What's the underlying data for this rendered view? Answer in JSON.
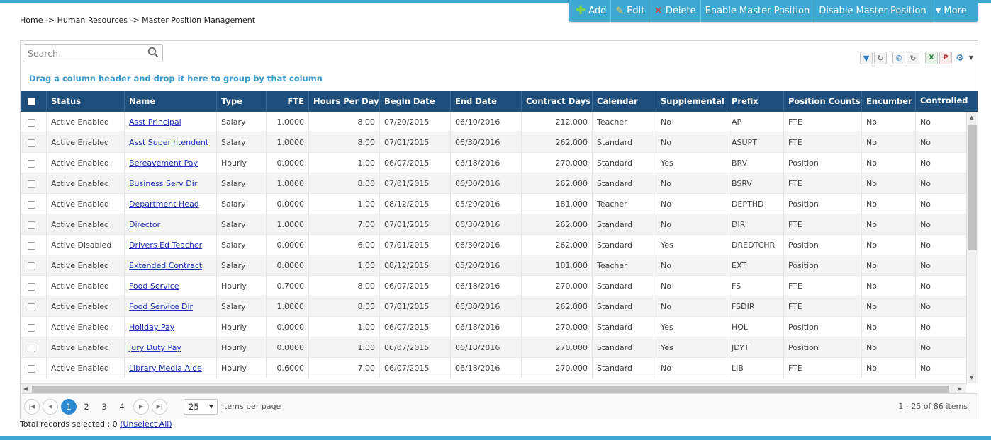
{
  "breadcrumb": "Home -> Human Resources -> Master Position Management",
  "toolbar": {
    "add": "Add",
    "edit": "Edit",
    "delete": "Delete",
    "enable": "Enable Master Position",
    "disable": "Disable Master Position",
    "more": "More"
  },
  "search": {
    "placeholder": "Search"
  },
  "group_hint": "Drag a column header and drop it here to group by that column",
  "columns": [
    "Status",
    "Name",
    "Type",
    "FTE",
    "Hours Per Day",
    "Begin Date",
    "End Date",
    "Contract Days",
    "Calendar",
    "Supplemental",
    "Prefix",
    "Position Counts",
    "Encumber",
    "Controlled"
  ],
  "rows": [
    [
      "Active Enabled",
      "Asst Principal",
      "Salary",
      "1.0000",
      "8.00",
      "07/20/2015",
      "06/10/2016",
      "212.000",
      "Teacher",
      "No",
      "AP",
      "FTE",
      "No",
      "No"
    ],
    [
      "Active Enabled",
      "Asst Superintendent",
      "Salary",
      "1.0000",
      "8.00",
      "07/01/2015",
      "06/30/2016",
      "262.000",
      "Standard",
      "No",
      "ASUPT",
      "FTE",
      "No",
      "No"
    ],
    [
      "Active Enabled",
      "Bereavement Pay",
      "Hourly",
      "0.0000",
      "1.00",
      "06/07/2015",
      "06/18/2016",
      "270.000",
      "Standard",
      "Yes",
      "BRV",
      "Position",
      "No",
      "No"
    ],
    [
      "Active Enabled",
      "Business Serv Dir",
      "Salary",
      "1.0000",
      "8.00",
      "07/01/2015",
      "06/30/2016",
      "262.000",
      "Standard",
      "No",
      "BSRV",
      "FTE",
      "No",
      "No"
    ],
    [
      "Active Enabled",
      "Department Head",
      "Salary",
      "0.0000",
      "1.00",
      "08/12/2015",
      "05/20/2016",
      "181.000",
      "Teacher",
      "No",
      "DEPTHD",
      "Position",
      "No",
      "No"
    ],
    [
      "Active Enabled",
      "Director",
      "Salary",
      "1.0000",
      "7.00",
      "07/01/2015",
      "06/30/2016",
      "262.000",
      "Standard",
      "No",
      "DIR",
      "FTE",
      "No",
      "No"
    ],
    [
      "Active Disabled",
      "Drivers Ed Teacher",
      "Salary",
      "0.0000",
      "6.00",
      "07/01/2015",
      "06/30/2016",
      "262.000",
      "Standard",
      "Yes",
      "DREDTCHR",
      "Position",
      "No",
      "No"
    ],
    [
      "Active Enabled",
      "Extended Contract",
      "Salary",
      "0.0000",
      "1.00",
      "08/12/2015",
      "05/20/2016",
      "181.000",
      "Teacher",
      "No",
      "EXT",
      "Position",
      "No",
      "No"
    ],
    [
      "Active Enabled",
      "Food Service",
      "Hourly",
      "0.7000",
      "8.00",
      "06/07/2015",
      "06/18/2016",
      "270.000",
      "Standard",
      "No",
      "FS",
      "FTE",
      "No",
      "No"
    ],
    [
      "Active Enabled",
      "Food Service Dir",
      "Salary",
      "1.0000",
      "8.00",
      "07/01/2015",
      "06/30/2016",
      "262.000",
      "Standard",
      "No",
      "FSDIR",
      "FTE",
      "No",
      "No"
    ],
    [
      "Active Enabled",
      "Holiday Pay",
      "Hourly",
      "0.0000",
      "1.00",
      "06/07/2015",
      "06/18/2016",
      "270.000",
      "Standard",
      "Yes",
      "HOL",
      "Position",
      "No",
      "No"
    ],
    [
      "Active Enabled",
      "Jury Duty Pay",
      "Hourly",
      "0.0000",
      "1.00",
      "06/07/2015",
      "06/18/2016",
      "270.000",
      "Standard",
      "Yes",
      "JDYT",
      "Position",
      "No",
      "No"
    ],
    [
      "Active Enabled",
      "Library Media Aide",
      "Hourly",
      "0.6000",
      "7.00",
      "06/07/2015",
      "06/18/2016",
      "270.000",
      "Standard",
      "No",
      "LIB",
      "FTE",
      "No",
      "No"
    ]
  ],
  "pager": {
    "pages": [
      "1",
      "2",
      "3",
      "4"
    ],
    "page_size": "25",
    "items_per_page": "items per page",
    "info": "1 - 25 of 86 items"
  },
  "records": {
    "label": "Total records selected : 0",
    "unselect": "(Unselect All)"
  },
  "colors": {
    "accent": "#3ea7d2",
    "header": "#1e4f7c",
    "link": "#1a2fb4"
  }
}
